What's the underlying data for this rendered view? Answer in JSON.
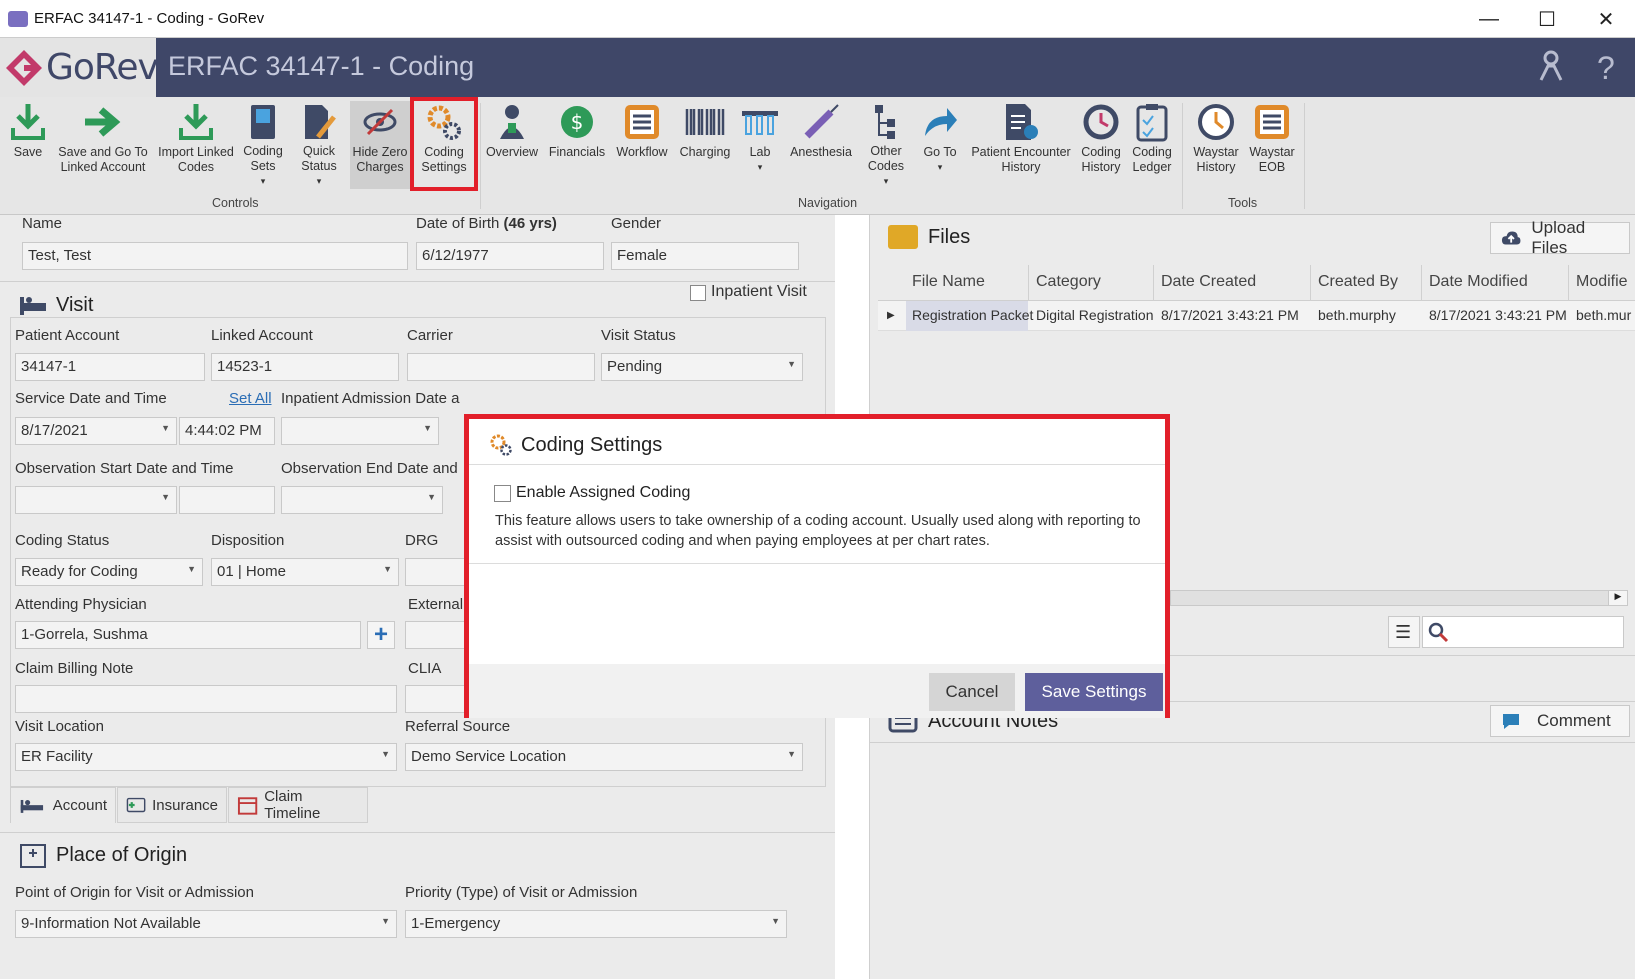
{
  "window": {
    "title": "ERFAC 34147-1 - Coding - GoRev",
    "minimize": "—",
    "maximize": "☐",
    "close": "✕"
  },
  "brand": {
    "logo_text": "GoRev",
    "title": "ERFAC 34147-1 - Coding"
  },
  "ribbon": {
    "controls": [
      {
        "label": "Save"
      },
      {
        "label": "Save and Go To Linked Account"
      },
      {
        "label": "Import Linked Codes"
      },
      {
        "label": "Coding Sets"
      },
      {
        "label": "Quick Status"
      },
      {
        "label": "Hide Zero Charges"
      },
      {
        "label": "Coding Settings"
      }
    ],
    "navigation": [
      {
        "label": "Overview"
      },
      {
        "label": "Financials"
      },
      {
        "label": "Workflow"
      },
      {
        "label": "Charging"
      },
      {
        "label": "Lab"
      },
      {
        "label": "Anesthesia"
      },
      {
        "label": "Other Codes"
      },
      {
        "label": "Go To"
      },
      {
        "label": "Patient Encounter History"
      },
      {
        "label": "Coding History"
      },
      {
        "label": "Coding Ledger"
      }
    ],
    "tools": [
      {
        "label": "Waystar History"
      },
      {
        "label": "Waystar EOB"
      }
    ],
    "group_controls": "Controls",
    "group_navigation": "Navigation",
    "group_tools": "Tools"
  },
  "patient": {
    "name_label": "Name",
    "name_value": "Test, Test",
    "dob_label": "Date of Birth",
    "dob_age": "(46 yrs)",
    "dob_value": "6/12/1977",
    "gender_label": "Gender",
    "gender_value": "Female"
  },
  "visit": {
    "heading": "Visit",
    "inpatient_label": "Inpatient Visit",
    "patient_account_label": "Patient Account",
    "patient_account_value": "34147-1",
    "linked_account_label": "Linked Account",
    "linked_account_value": "14523-1",
    "carrier_label": "Carrier",
    "carrier_value": "",
    "visit_status_label": "Visit Status",
    "visit_status_value": "Pending",
    "service_dt_label": "Service Date and Time",
    "set_all": "Set All",
    "service_date": "8/17/2021",
    "service_time": "4:44:02 PM",
    "inpatient_admit_label": "Inpatient Admission Date a",
    "obs_start_label": "Observation Start Date and Time",
    "obs_end_label": "Observation End Date and",
    "coding_status_label": "Coding Status",
    "coding_status_value": "Ready for Coding",
    "disposition_label": "Disposition",
    "disposition_value": "01 | Home",
    "drg_label": "DRG",
    "attending_label": "Attending Physician",
    "attending_value": "1-Gorrela, Sushma",
    "external_label": "External",
    "claim_note_label": "Claim Billing Note",
    "clia_label": "CLIA",
    "visit_location_label": "Visit Location",
    "visit_location_value": "ER Facility",
    "referral_label": "Referral Source",
    "referral_value": "Demo Service Location"
  },
  "tabs": [
    {
      "label": "Account"
    },
    {
      "label": "Insurance"
    },
    {
      "label": "Claim Timeline"
    }
  ],
  "origin": {
    "heading": "Place of Origin",
    "point_label": "Point of Origin for Visit or Admission",
    "point_value": "9-Information Not Available",
    "priority_label": "Priority (Type) of Visit or Admission",
    "priority_value": "1-Emergency"
  },
  "files": {
    "heading": "Files",
    "upload_label": "Upload Files",
    "columns": [
      "File Name",
      "Category",
      "Date Created",
      "Created By",
      "Date Modified",
      "Modifie"
    ],
    "rows": [
      [
        "Registration Packet",
        "Digital Registration",
        "8/17/2021 3:43:21 PM",
        "beth.murphy",
        "8/17/2021 3:43:21 PM",
        "beth.mur"
      ]
    ]
  },
  "notes": {
    "heading": "Account Notes",
    "comment_label": "Comment"
  },
  "dialog": {
    "title": "Coding Settings",
    "checkbox_label": "Enable Assigned Coding",
    "description": "This feature allows users to take ownership of a coding account. Usually used along with reporting to assist with outsourced coding and when paying employees at per chart rates.",
    "cancel_label": "Cancel",
    "save_label": "Save Settings"
  },
  "colors": {
    "brand": "#3f4768",
    "highlight": "#e21f2a",
    "primary_button": "#5e5f9c",
    "link": "#2a6db5"
  }
}
